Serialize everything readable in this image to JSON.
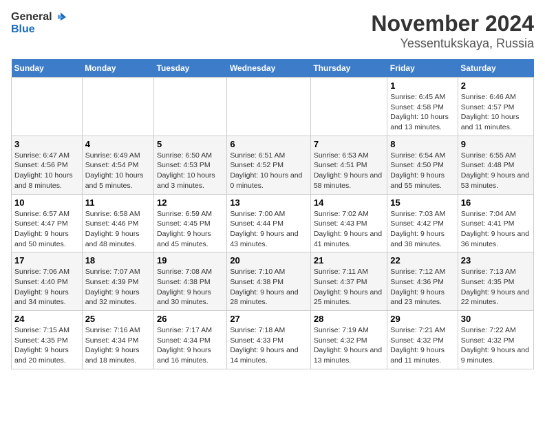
{
  "header": {
    "logo_general": "General",
    "logo_blue": "Blue",
    "title": "November 2024",
    "subtitle": "Yessentukskaya, Russia"
  },
  "calendar": {
    "columns": [
      "Sunday",
      "Monday",
      "Tuesday",
      "Wednesday",
      "Thursday",
      "Friday",
      "Saturday"
    ],
    "weeks": [
      [
        {
          "day": "",
          "info": ""
        },
        {
          "day": "",
          "info": ""
        },
        {
          "day": "",
          "info": ""
        },
        {
          "day": "",
          "info": ""
        },
        {
          "day": "",
          "info": ""
        },
        {
          "day": "1",
          "info": "Sunrise: 6:45 AM\nSunset: 4:58 PM\nDaylight: 10 hours\nand 13 minutes."
        },
        {
          "day": "2",
          "info": "Sunrise: 6:46 AM\nSunset: 4:57 PM\nDaylight: 10 hours\nand 11 minutes."
        }
      ],
      [
        {
          "day": "3",
          "info": "Sunrise: 6:47 AM\nSunset: 4:56 PM\nDaylight: 10 hours\nand 8 minutes."
        },
        {
          "day": "4",
          "info": "Sunrise: 6:49 AM\nSunset: 4:54 PM\nDaylight: 10 hours\nand 5 minutes."
        },
        {
          "day": "5",
          "info": "Sunrise: 6:50 AM\nSunset: 4:53 PM\nDaylight: 10 hours\nand 3 minutes."
        },
        {
          "day": "6",
          "info": "Sunrise: 6:51 AM\nSunset: 4:52 PM\nDaylight: 10 hours\nand 0 minutes."
        },
        {
          "day": "7",
          "info": "Sunrise: 6:53 AM\nSunset: 4:51 PM\nDaylight: 9 hours\nand 58 minutes."
        },
        {
          "day": "8",
          "info": "Sunrise: 6:54 AM\nSunset: 4:50 PM\nDaylight: 9 hours\nand 55 minutes."
        },
        {
          "day": "9",
          "info": "Sunrise: 6:55 AM\nSunset: 4:48 PM\nDaylight: 9 hours\nand 53 minutes."
        }
      ],
      [
        {
          "day": "10",
          "info": "Sunrise: 6:57 AM\nSunset: 4:47 PM\nDaylight: 9 hours\nand 50 minutes."
        },
        {
          "day": "11",
          "info": "Sunrise: 6:58 AM\nSunset: 4:46 PM\nDaylight: 9 hours\nand 48 minutes."
        },
        {
          "day": "12",
          "info": "Sunrise: 6:59 AM\nSunset: 4:45 PM\nDaylight: 9 hours\nand 45 minutes."
        },
        {
          "day": "13",
          "info": "Sunrise: 7:00 AM\nSunset: 4:44 PM\nDaylight: 9 hours\nand 43 minutes."
        },
        {
          "day": "14",
          "info": "Sunrise: 7:02 AM\nSunset: 4:43 PM\nDaylight: 9 hours\nand 41 minutes."
        },
        {
          "day": "15",
          "info": "Sunrise: 7:03 AM\nSunset: 4:42 PM\nDaylight: 9 hours\nand 38 minutes."
        },
        {
          "day": "16",
          "info": "Sunrise: 7:04 AM\nSunset: 4:41 PM\nDaylight: 9 hours\nand 36 minutes."
        }
      ],
      [
        {
          "day": "17",
          "info": "Sunrise: 7:06 AM\nSunset: 4:40 PM\nDaylight: 9 hours\nand 34 minutes."
        },
        {
          "day": "18",
          "info": "Sunrise: 7:07 AM\nSunset: 4:39 PM\nDaylight: 9 hours\nand 32 minutes."
        },
        {
          "day": "19",
          "info": "Sunrise: 7:08 AM\nSunset: 4:38 PM\nDaylight: 9 hours\nand 30 minutes."
        },
        {
          "day": "20",
          "info": "Sunrise: 7:10 AM\nSunset: 4:38 PM\nDaylight: 9 hours\nand 28 minutes."
        },
        {
          "day": "21",
          "info": "Sunrise: 7:11 AM\nSunset: 4:37 PM\nDaylight: 9 hours\nand 25 minutes."
        },
        {
          "day": "22",
          "info": "Sunrise: 7:12 AM\nSunset: 4:36 PM\nDaylight: 9 hours\nand 23 minutes."
        },
        {
          "day": "23",
          "info": "Sunrise: 7:13 AM\nSunset: 4:35 PM\nDaylight: 9 hours\nand 22 minutes."
        }
      ],
      [
        {
          "day": "24",
          "info": "Sunrise: 7:15 AM\nSunset: 4:35 PM\nDaylight: 9 hours\nand 20 minutes."
        },
        {
          "day": "25",
          "info": "Sunrise: 7:16 AM\nSunset: 4:34 PM\nDaylight: 9 hours\nand 18 minutes."
        },
        {
          "day": "26",
          "info": "Sunrise: 7:17 AM\nSunset: 4:34 PM\nDaylight: 9 hours\nand 16 minutes."
        },
        {
          "day": "27",
          "info": "Sunrise: 7:18 AM\nSunset: 4:33 PM\nDaylight: 9 hours\nand 14 minutes."
        },
        {
          "day": "28",
          "info": "Sunrise: 7:19 AM\nSunset: 4:32 PM\nDaylight: 9 hours\nand 13 minutes."
        },
        {
          "day": "29",
          "info": "Sunrise: 7:21 AM\nSunset: 4:32 PM\nDaylight: 9 hours\nand 11 minutes."
        },
        {
          "day": "30",
          "info": "Sunrise: 7:22 AM\nSunset: 4:32 PM\nDaylight: 9 hours\nand 9 minutes."
        }
      ]
    ]
  }
}
